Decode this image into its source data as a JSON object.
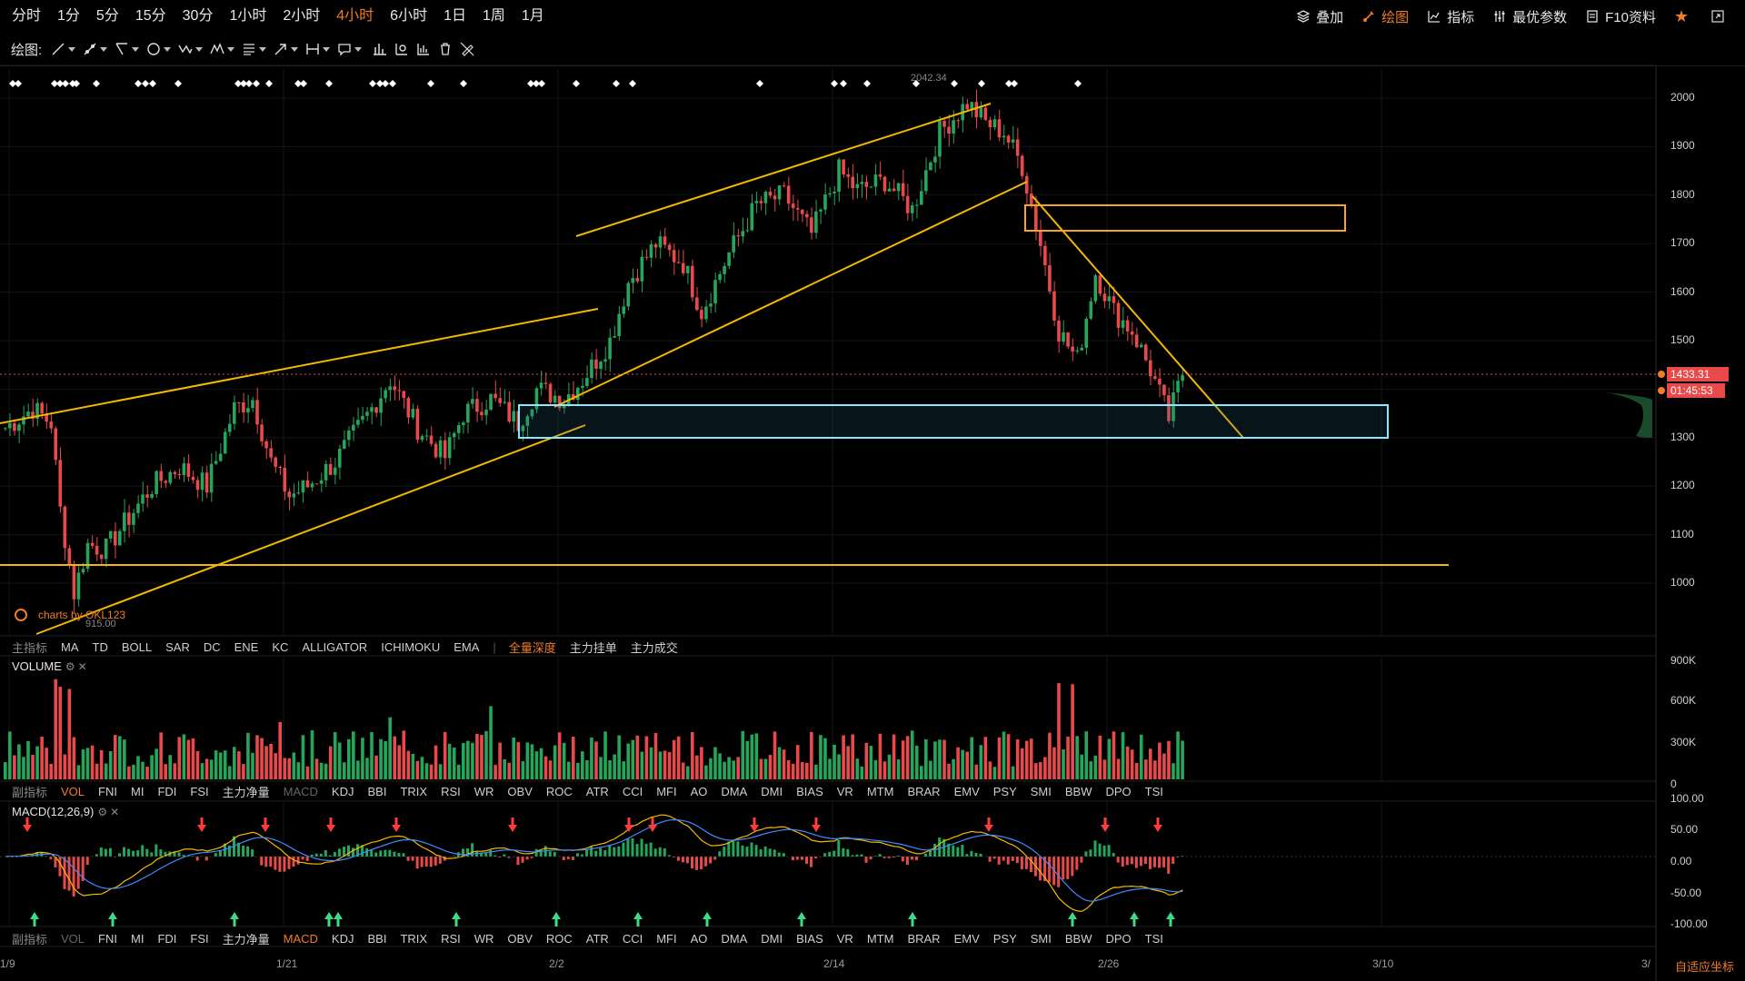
{
  "timeframes": [
    "分时",
    "1分",
    "5分",
    "15分",
    "30分",
    "1小时",
    "2小时",
    "4小时",
    "6小时",
    "1日",
    "1周",
    "1月"
  ],
  "active_timeframe": "4小时",
  "right_tools": {
    "overlay": "叠加",
    "draw": "绘图",
    "indicator": "指标",
    "best_params": "最优参数",
    "f10": "F10资料"
  },
  "drawbar_label": "绘图:",
  "price_axis": [
    "2000",
    "1900",
    "1800",
    "1700",
    "1600",
    "1500",
    "1400",
    "1300",
    "1200",
    "1100",
    "1000"
  ],
  "current_price": "1433.31",
  "countdown": "01:45:53",
  "high_label": "2042.34",
  "low_label": "915.00",
  "watermark": "charts by OKL123",
  "main_tabs": {
    "label": "主指标",
    "items": [
      "MA",
      "TD",
      "BOLL",
      "SAR",
      "DC",
      "ENE",
      "KC",
      "ALLIGATOR",
      "ICHIMOKU",
      "EMA"
    ],
    "extra": [
      "全量深度",
      "主力挂单",
      "主力成交"
    ]
  },
  "volume": {
    "title": "VOLUME",
    "axis": [
      "900K",
      "600K",
      "300K",
      "0"
    ]
  },
  "sub_tabs": {
    "label": "副指标",
    "items": [
      "VOL",
      "FNI",
      "MI",
      "FDI",
      "FSI",
      "主力净量",
      "MACD",
      "KDJ",
      "BBI",
      "TRIX",
      "RSI",
      "WR",
      "OBV",
      "ROC",
      "ATR",
      "CCI",
      "MFI",
      "AO",
      "DMA",
      "DMI",
      "BIAS",
      "VR",
      "MTM",
      "BRAR",
      "EMV",
      "PSY",
      "SMI",
      "BBW",
      "DPO",
      "TSI"
    ]
  },
  "macd": {
    "title": "MACD(12,26,9)",
    "axis": [
      "100.00",
      "50.00",
      "0.00",
      "-50.00",
      "-100.00"
    ]
  },
  "date_axis": [
    "1/9",
    "1/21",
    "2/2",
    "2/14",
    "2/26",
    "3/10",
    "3/"
  ],
  "auto_scale": "自适应坐标",
  "colors": {
    "up": "#26a65b",
    "down": "#e84a4a",
    "accent": "#f07c2a",
    "trendline": "#f5b800",
    "box_cyan": "#8fe6ff"
  }
}
